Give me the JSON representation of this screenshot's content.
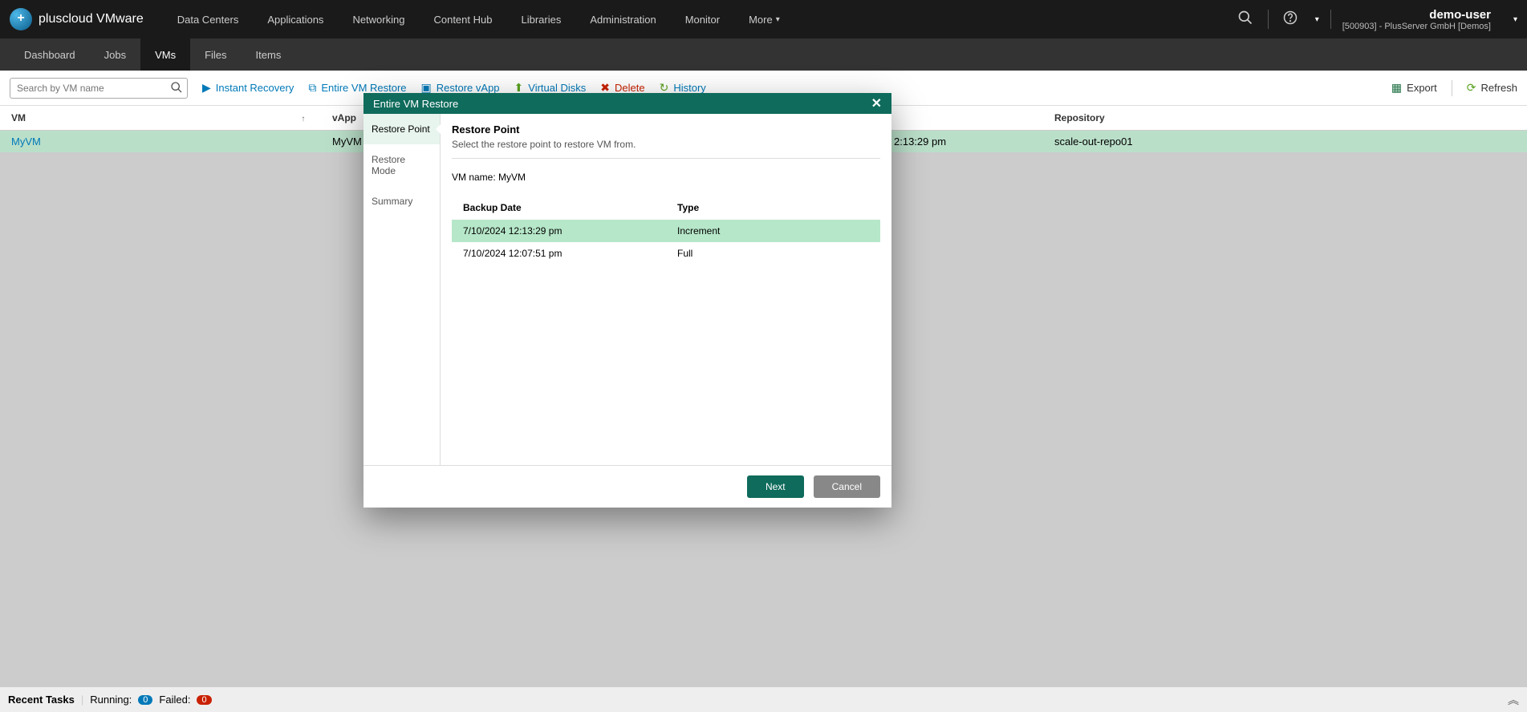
{
  "brand": "pluscloud VMware",
  "nav": [
    "Data Centers",
    "Applications",
    "Networking",
    "Content Hub",
    "Libraries",
    "Administration",
    "Monitor"
  ],
  "more": "More",
  "user": {
    "name": "demo-user",
    "org": "[500903] - PlusServer GmbH [Demos]"
  },
  "subtabs": [
    "Dashboard",
    "Jobs",
    "VMs",
    "Files",
    "Items"
  ],
  "subtabs_active": 2,
  "search_placeholder": "Search by VM name",
  "actions": {
    "instant": "Instant Recovery",
    "entirevm": "Entire VM Restore",
    "vapp": "Restore vApp",
    "vdisks": "Virtual Disks",
    "delete": "Delete",
    "history": "History",
    "export": "Export",
    "refresh": "Refresh"
  },
  "table": {
    "cols": {
      "vm": "VM",
      "vapp": "vApp",
      "restore_ts": "2:13:29 pm",
      "repo": "Repository"
    },
    "row": {
      "vm": "MyVM",
      "vapp": "MyVM",
      "repo": "scale-out-repo01"
    }
  },
  "modal": {
    "title": "Entire VM Restore",
    "steps": [
      "Restore Point",
      "Restore Mode",
      "Summary"
    ],
    "active_step": 0,
    "heading": "Restore Point",
    "desc": "Select the restore point to restore VM from.",
    "vmname_label": "VM name: ",
    "vmname": "MyVM",
    "rp_cols": {
      "date": "Backup Date",
      "type": "Type"
    },
    "rows": [
      {
        "date": "7/10/2024 12:13:29 pm",
        "type": "Increment",
        "sel": true
      },
      {
        "date": "7/10/2024 12:07:51 pm",
        "type": "Full",
        "sel": false
      }
    ],
    "next": "Next",
    "cancel": "Cancel"
  },
  "recent": {
    "label": "Recent Tasks",
    "running_label": "Running:",
    "running": "0",
    "failed_label": "Failed:",
    "failed": "0"
  }
}
